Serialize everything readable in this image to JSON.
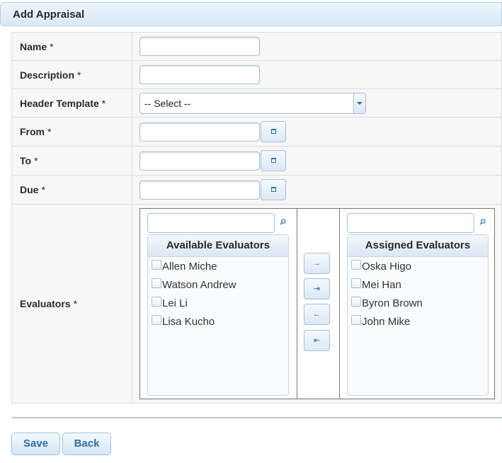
{
  "header": {
    "title": "Add Appraisal"
  },
  "form": {
    "required_mark": "*",
    "name_label": "Name",
    "description_label": "Description",
    "header_template_label": "Header Template",
    "header_template_value": "-- Select --",
    "from_label": "From",
    "to_label": "To",
    "due_label": "Due",
    "evaluators_label": "Evaluators"
  },
  "evaluators": {
    "available_title": "Available Evaluators",
    "assigned_title": "Assigned Evaluators",
    "available": [
      "Allen Miche",
      "Watson Andrew",
      "Lei Li",
      "Lisa Kucho"
    ],
    "assigned": [
      "Oska Higo",
      "Mei Han",
      "Byron Brown",
      "John Mike"
    ],
    "move_buttons": [
      "→",
      "⇥",
      "←",
      "⇤"
    ]
  },
  "footer": {
    "save_label": "Save",
    "back_label": "Back"
  },
  "colors": {
    "accent": "#2e6fa8",
    "border": "#a7bfd6",
    "header_bg": "#d9e8f6"
  }
}
